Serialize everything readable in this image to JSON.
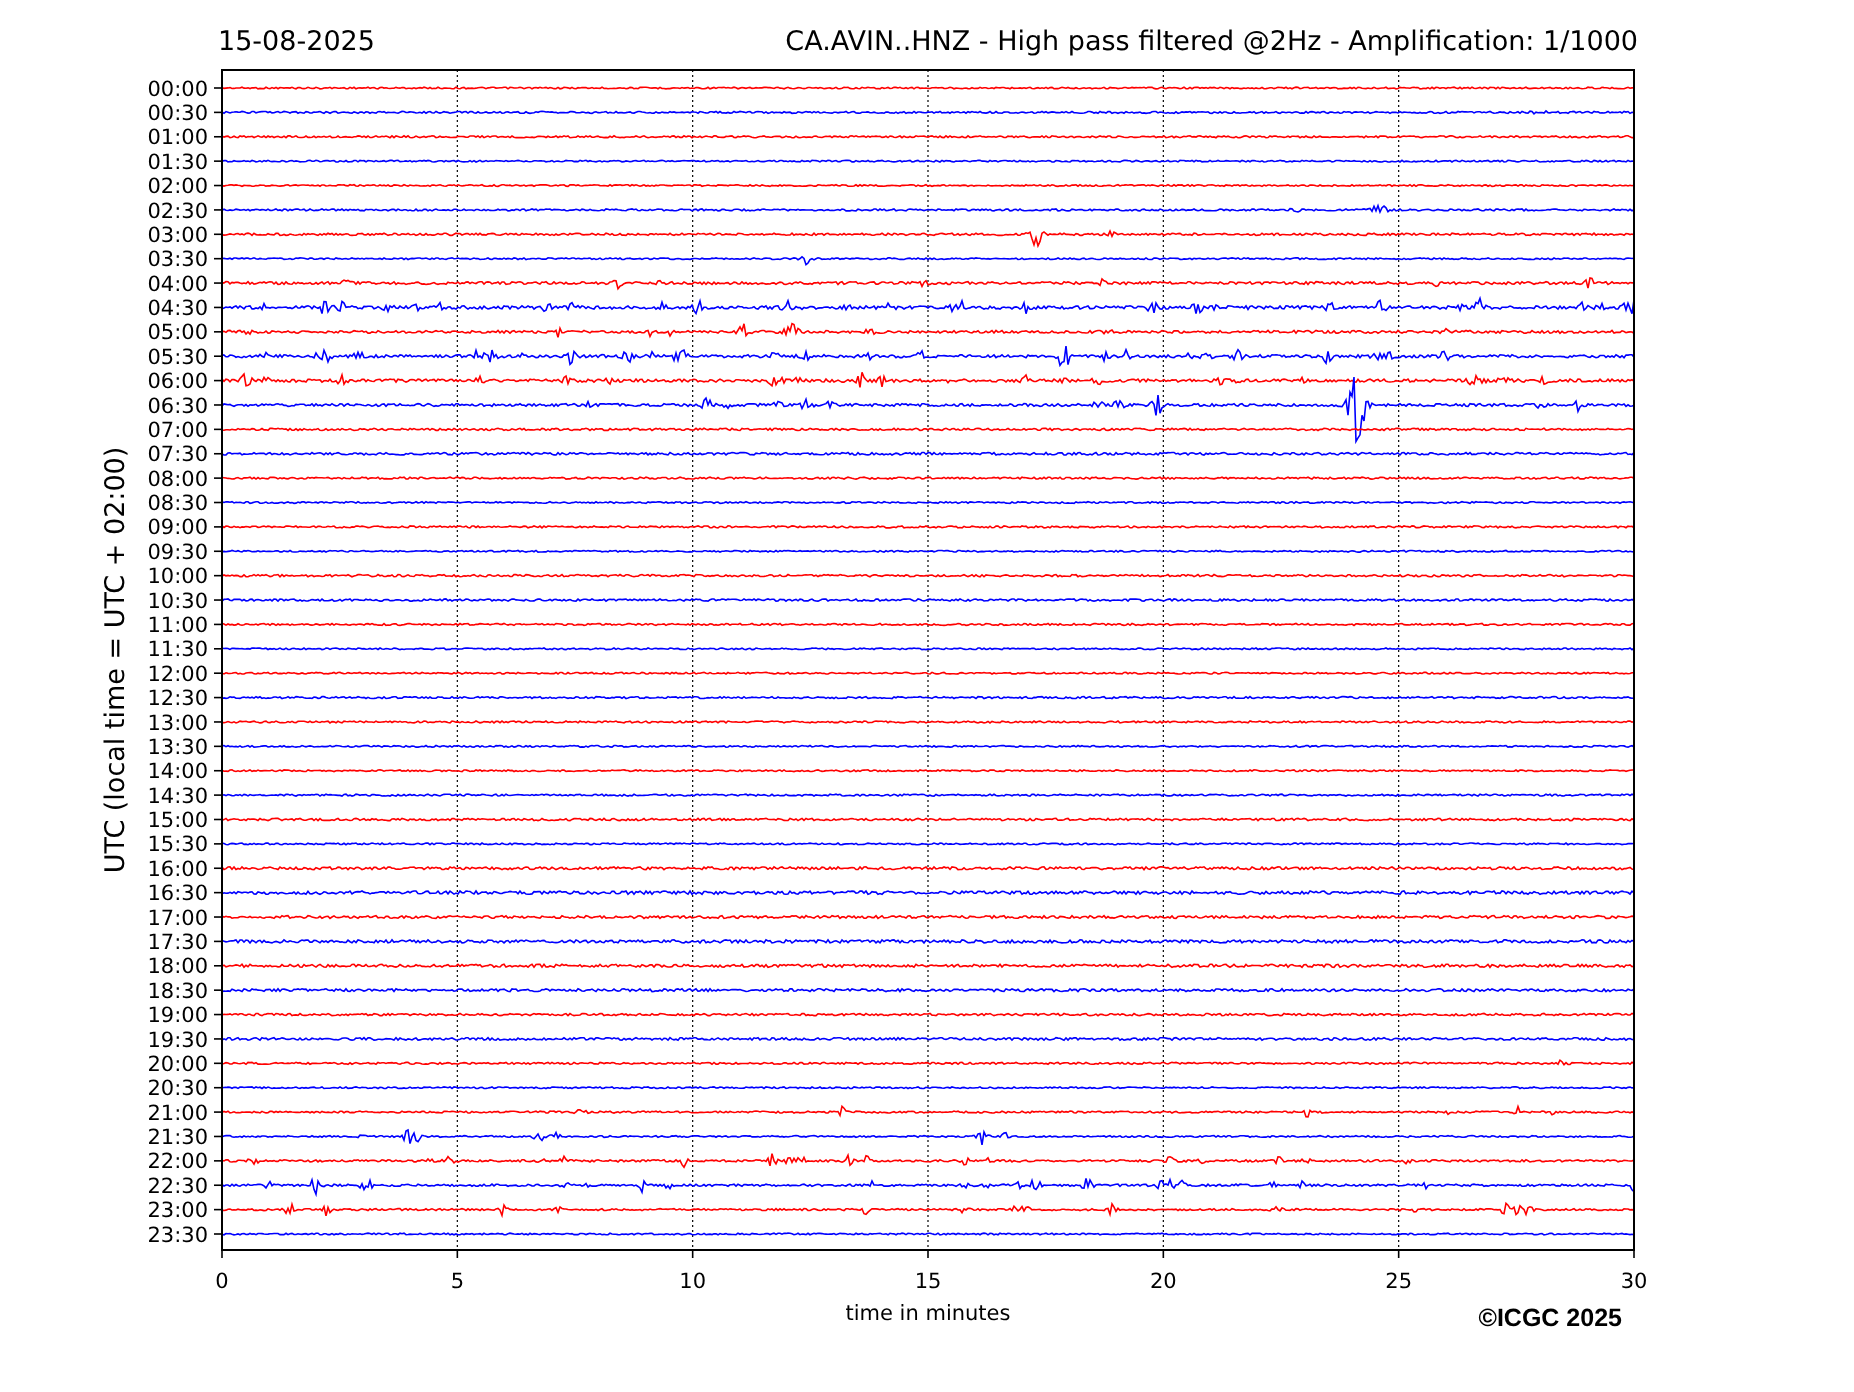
{
  "date": "15-08-2025",
  "title": "CA.AVIN..HNZ - High pass filtered @2Hz - Amplification: 1/1000",
  "ylabel": "UTC (local time = UTC + 02:00)",
  "xlabel": "time in minutes",
  "xticks": [
    "0",
    "5",
    "10",
    "15",
    "20",
    "25",
    "30"
  ],
  "rows": [
    {
      "label": "00:00",
      "color": "#ff0000"
    },
    {
      "label": "00:30",
      "color": "#0000ff"
    },
    {
      "label": "01:00",
      "color": "#ff0000"
    },
    {
      "label": "01:30",
      "color": "#0000ff"
    },
    {
      "label": "02:00",
      "color": "#ff0000"
    },
    {
      "label": "02:30",
      "color": "#0000ff"
    },
    {
      "label": "03:00",
      "color": "#ff0000"
    },
    {
      "label": "03:30",
      "color": "#0000ff"
    },
    {
      "label": "04:00",
      "color": "#ff0000"
    },
    {
      "label": "04:30",
      "color": "#0000ff"
    },
    {
      "label": "05:00",
      "color": "#ff0000"
    },
    {
      "label": "05:30",
      "color": "#0000ff"
    },
    {
      "label": "06:00",
      "color": "#ff0000"
    },
    {
      "label": "06:30",
      "color": "#0000ff"
    },
    {
      "label": "07:00",
      "color": "#ff0000"
    },
    {
      "label": "07:30",
      "color": "#0000ff"
    },
    {
      "label": "08:00",
      "color": "#ff0000"
    },
    {
      "label": "08:30",
      "color": "#0000ff"
    },
    {
      "label": "09:00",
      "color": "#ff0000"
    },
    {
      "label": "09:30",
      "color": "#0000ff"
    },
    {
      "label": "10:00",
      "color": "#ff0000"
    },
    {
      "label": "10:30",
      "color": "#0000ff"
    },
    {
      "label": "11:00",
      "color": "#ff0000"
    },
    {
      "label": "11:30",
      "color": "#0000ff"
    },
    {
      "label": "12:00",
      "color": "#ff0000"
    },
    {
      "label": "12:30",
      "color": "#0000ff"
    },
    {
      "label": "13:00",
      "color": "#ff0000"
    },
    {
      "label": "13:30",
      "color": "#0000ff"
    },
    {
      "label": "14:00",
      "color": "#ff0000"
    },
    {
      "label": "14:30",
      "color": "#0000ff"
    },
    {
      "label": "15:00",
      "color": "#ff0000"
    },
    {
      "label": "15:30",
      "color": "#0000ff"
    },
    {
      "label": "16:00",
      "color": "#ff0000"
    },
    {
      "label": "16:30",
      "color": "#0000ff"
    },
    {
      "label": "17:00",
      "color": "#ff0000"
    },
    {
      "label": "17:30",
      "color": "#0000ff"
    },
    {
      "label": "18:00",
      "color": "#ff0000"
    },
    {
      "label": "18:30",
      "color": "#0000ff"
    },
    {
      "label": "19:00",
      "color": "#ff0000"
    },
    {
      "label": "19:30",
      "color": "#0000ff"
    },
    {
      "label": "20:00",
      "color": "#ff0000"
    },
    {
      "label": "20:30",
      "color": "#0000ff"
    },
    {
      "label": "21:00",
      "color": "#ff0000"
    },
    {
      "label": "21:30",
      "color": "#0000ff"
    },
    {
      "label": "22:00",
      "color": "#ff0000"
    },
    {
      "label": "22:30",
      "color": "#0000ff"
    },
    {
      "label": "23:00",
      "color": "#ff0000"
    },
    {
      "label": "23:30",
      "color": "#0000ff"
    }
  ],
  "copyright": "©ICGC 2025"
}
